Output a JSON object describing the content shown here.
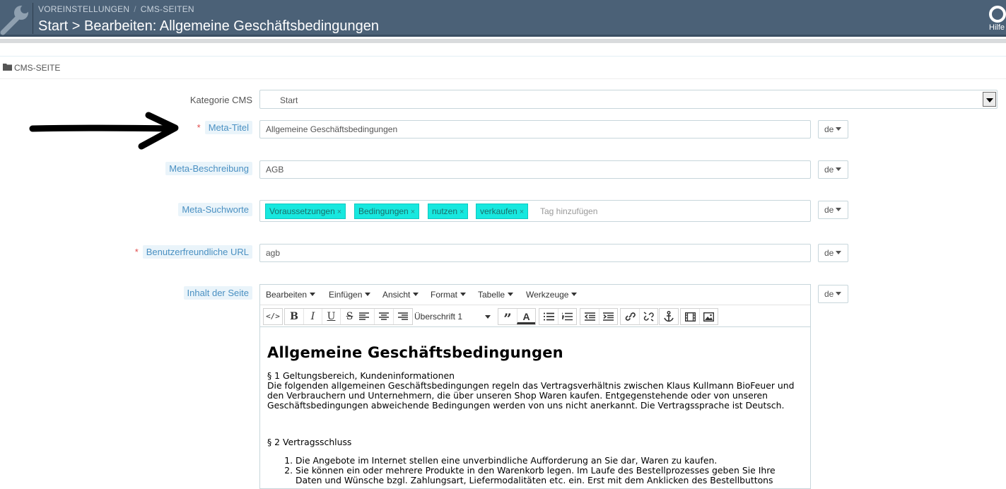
{
  "header": {
    "breadcrumb": [
      "VOREINSTELLUNGEN",
      "CMS-SEITEN"
    ],
    "breadcrumb_sep": "/",
    "title": "Start > Bearbeiten: Allgemeine Geschäftsbedingungen",
    "help_label": "Hilfe"
  },
  "panel": {
    "title": "CMS-SEITE"
  },
  "form": {
    "category": {
      "label": "Kategorie CMS",
      "value": "Start"
    },
    "meta_title": {
      "label": "Meta-Titel",
      "value": "Allgemeine Geschäftsbedingungen",
      "required": "*"
    },
    "meta_description": {
      "label": "Meta-Beschreibung",
      "value": "AGB"
    },
    "meta_keywords": {
      "label": "Meta-Suchworte",
      "tags": [
        "Voraussetzungen",
        "Bedingungen",
        "nutzen",
        "verkaufen"
      ],
      "remove_glyph": "×",
      "placeholder": "Tag hinzufügen"
    },
    "friendly_url": {
      "label": "Benutzerfreundliche URL",
      "value": "agb",
      "required": "*"
    },
    "content": {
      "label": "Inhalt der Seite"
    },
    "lang": "de"
  },
  "editor": {
    "menus": [
      "Bearbeiten",
      "Einfügen",
      "Ansicht",
      "Format",
      "Tabelle",
      "Werkzeuge"
    ],
    "block_format": "Überschrift 1",
    "toolbar_icons": [
      "source-code",
      "bold",
      "italic",
      "underline",
      "strikethrough",
      "align-left",
      "align-center",
      "align-right",
      "blockquote",
      "text-color",
      "bullet-list",
      "numbered-list",
      "outdent",
      "indent",
      "link",
      "unlink",
      "anchor",
      "media",
      "image"
    ],
    "doc": {
      "heading": "Allgemeine Geschäftsbedingungen",
      "s1_title": "§ 1 Geltungsbereich, Kundeninformationen",
      "s1_body": "Die folgenden allgemeinen Geschäftsbedingungen regeln das Vertragsverhältnis zwischen Klaus Kullmann BioFeuer und den Verbrauchern und Unternehmern, die über unseren Shop Waren kaufen. Entgegenstehende oder von unseren Geschäftsbedingungen abweichende Bedingungen werden von uns nicht anerkannt. Die Vertragssprache ist Deutsch.",
      "s2_title": "§ 2 Vertragsschluss",
      "s2_items": [
        "Die Angebote im Internet stellen eine unverbindliche Aufforderung an Sie dar, Waren zu kaufen.",
        "Sie können ein oder mehrere Produkte in den Warenkorb legen. Im Laufe des Bestellprozesses geben Sie Ihre Daten und Wünsche bzgl. Zahlungsart, Liefermodalitäten etc. ein. Erst mit dem Anklicken des Bestellbuttons"
      ]
    }
  }
}
